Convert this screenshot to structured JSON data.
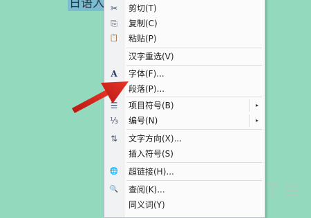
{
  "document": {
    "selected_text": "日语入"
  },
  "context_menu": {
    "items": [
      {
        "label": "剪切(T)",
        "icon": "scissors-icon",
        "glyph": "✂"
      },
      {
        "label": "复制(C)",
        "icon": "copy-icon",
        "glyph": "⎘"
      },
      {
        "label": "粘贴(P)",
        "icon": "paste-icon",
        "glyph": "📋"
      },
      {
        "label": "汉字重选(V)",
        "icon": "",
        "glyph": ""
      },
      {
        "label": "字体(F)...",
        "icon": "font-icon",
        "glyph": "A"
      },
      {
        "label": "段落(P)...",
        "icon": "paragraph-icon",
        "glyph": "≡"
      },
      {
        "label": "项目符号(B)",
        "icon": "bullets-icon",
        "glyph": "☰",
        "submenu": true
      },
      {
        "label": "编号(N)",
        "icon": "numbering-icon",
        "glyph": "⅓",
        "submenu": true
      },
      {
        "label": "文字方向(X)...",
        "icon": "text-direction-icon",
        "glyph": "⇅"
      },
      {
        "label": "插入符号(S)",
        "icon": "",
        "glyph": ""
      },
      {
        "label": "超链接(H)...",
        "icon": "hyperlink-icon",
        "glyph": "🌐"
      },
      {
        "label": "查阅(K)...",
        "icon": "research-icon",
        "glyph": "🔍"
      },
      {
        "label": "同义词(Y)",
        "icon": "",
        "glyph": ""
      }
    ],
    "submenu_glyph": "▸"
  },
  "colors": {
    "background": "#93d9bd",
    "selection": "#7bbcd1",
    "arrow": "#d9241c"
  }
}
